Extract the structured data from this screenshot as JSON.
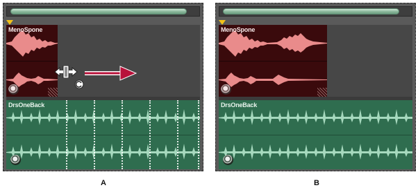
{
  "panels": [
    {
      "id": "A",
      "caption": "A",
      "clip_name": "MenoSpone",
      "drum_name": "DrsOneBack"
    },
    {
      "id": "B",
      "caption": "B",
      "clip_name": "MenoSpone",
      "drum_name": "DrsOneBack"
    }
  ],
  "colors": {
    "clip_bg": "#3a0a0c",
    "clip_wave": "#e98b8b",
    "drum_bg": "#2f6d4f",
    "drum_wave": "#a6d9be",
    "arrow": "#b8123a",
    "marker": "#f2c21a"
  },
  "icons": {
    "trim_cursor": "trim-cursor-icon",
    "rotate": "rotate-icon",
    "drag_arrow": "arrow-right-icon",
    "loop": "loop-icon",
    "playhead_marker": "playhead-marker-icon"
  }
}
